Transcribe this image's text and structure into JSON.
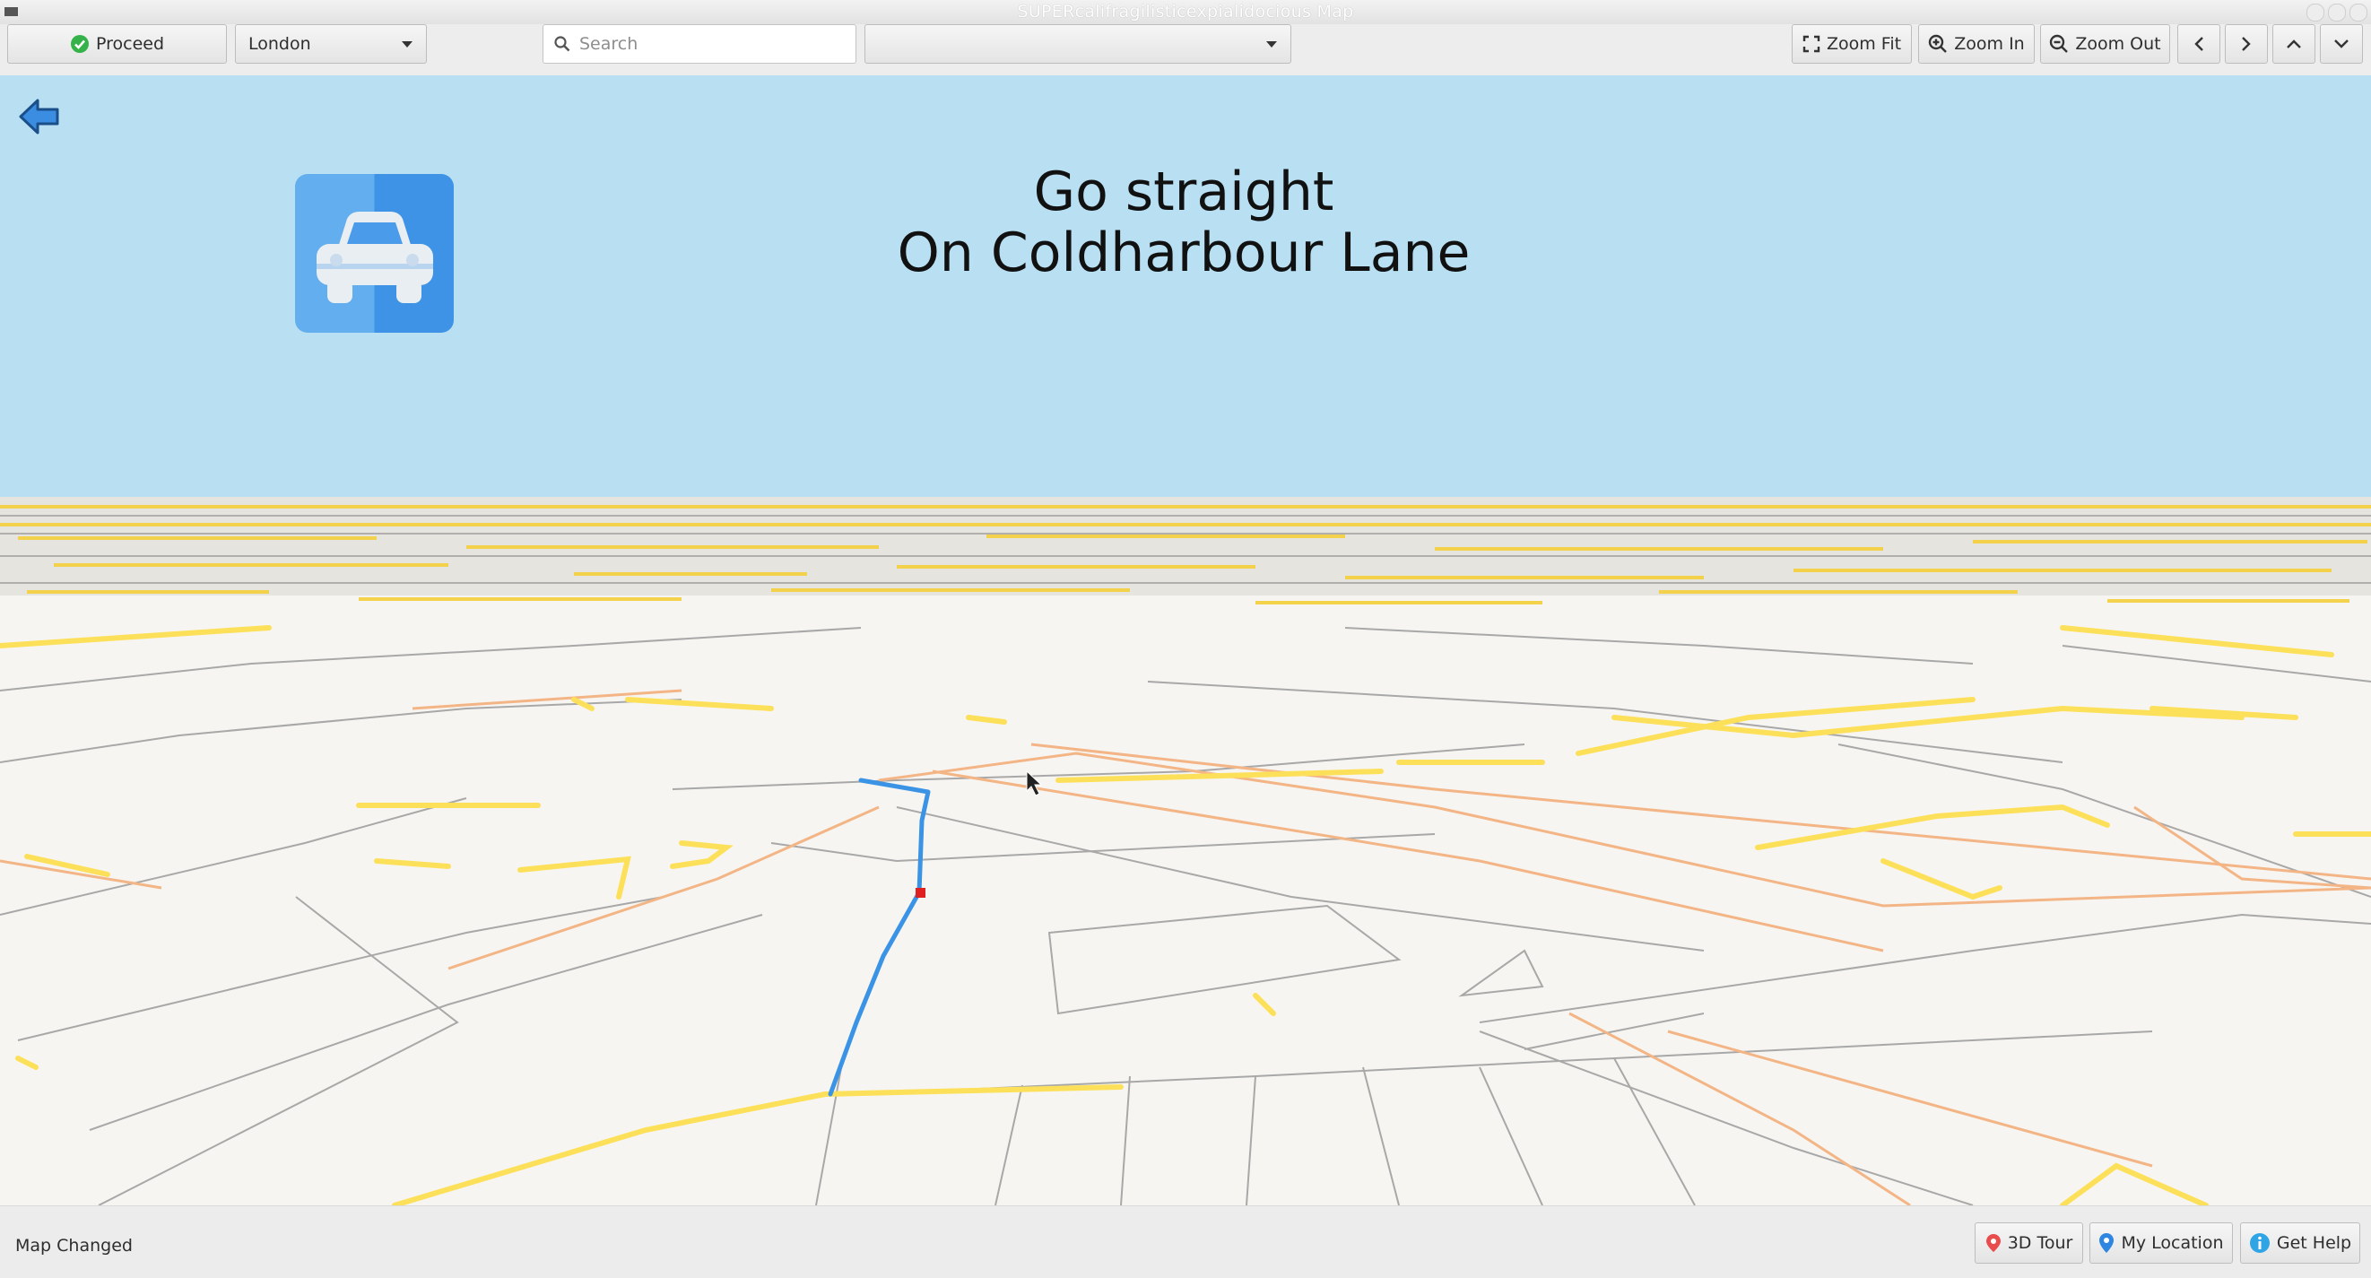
{
  "window": {
    "title": "SUPERcalifragilisticexpialidocious Map"
  },
  "toolbar": {
    "proceed_label": "Proceed",
    "city_value": "London",
    "search_placeholder": "Search",
    "route_select_value": "",
    "zoom_fit_label": "Zoom Fit",
    "zoom_in_label": "Zoom In",
    "zoom_out_label": "Zoom Out"
  },
  "guidance": {
    "instruction": "Go straight",
    "street": "On Coldharbour Lane",
    "vehicle_icon": "car-icon"
  },
  "map": {
    "sky_color": "#b8dff2",
    "ground_color": "#f7f5f1",
    "major_road_color": "#fde05a",
    "secondary_road_color": "#f3b585",
    "route_color": "#3a93e5",
    "current_position_color": "#e02020"
  },
  "status": {
    "message": "Map Changed",
    "tour_label": "3D Tour",
    "location_label": "My Location",
    "help_label": "Get Help"
  }
}
